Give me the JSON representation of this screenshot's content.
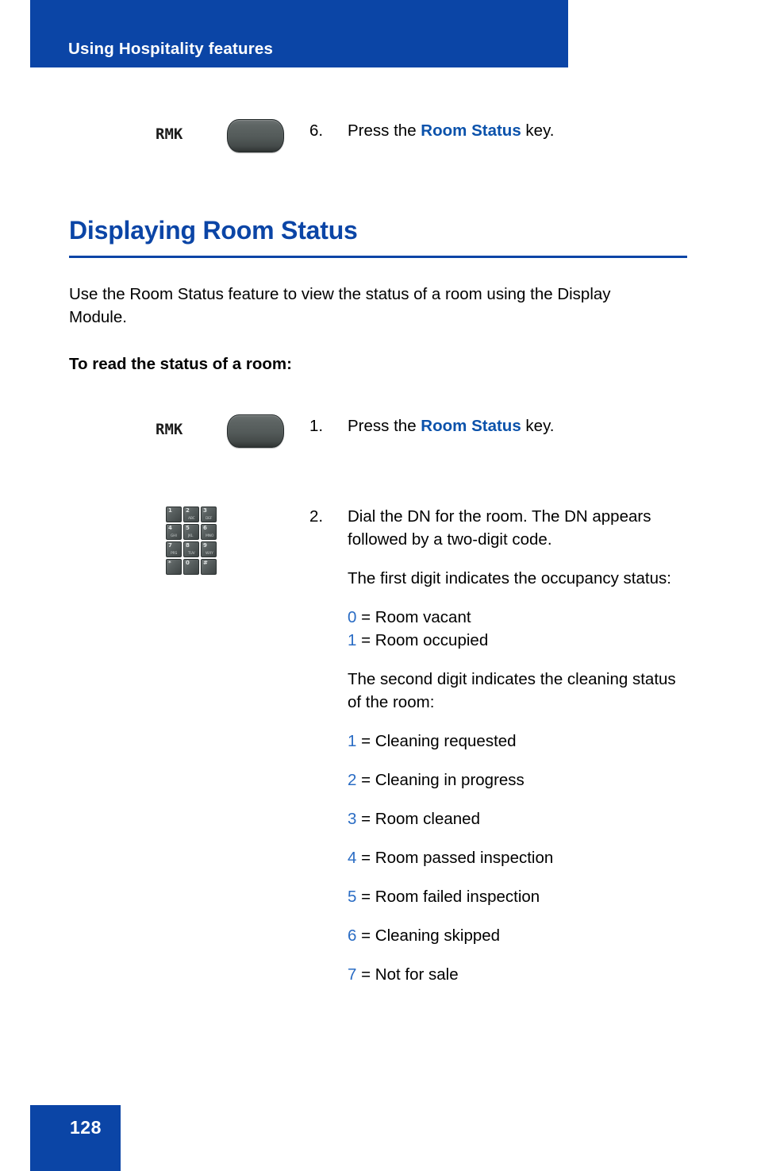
{
  "header": {
    "title": "Using Hospitality features",
    "banner_color": "#0b45a6"
  },
  "section": {
    "heading": "Displaying Room Status",
    "rule_color": "#0b45a6",
    "intro": "Use the Room Status feature to view the status of a room using the Display Module.",
    "subheading": "To read the status of a room:"
  },
  "steps": [
    {
      "number": "6.",
      "icon_label": "RMK",
      "text_before": "Press the ",
      "keyword": "Room Status",
      "text_after": " key."
    },
    {
      "number": "1.",
      "icon_label": "RMK",
      "text_before": "Press the ",
      "keyword": "Room Status",
      "text_after": " key."
    },
    {
      "number": "2.",
      "paragraphs": [
        "Dial the DN for the room. The DN appears followed by a two-digit code.",
        "The first digit indicates the occupancy status:",
        "The second digit indicates the cleaning status of the room:"
      ]
    }
  ],
  "occupancy_codes": [
    {
      "digit": "0",
      "equals": " = ",
      "meaning": "Room vacant"
    },
    {
      "digit": "1",
      "equals": " = ",
      "meaning": "Room occupied"
    }
  ],
  "cleaning_codes": [
    {
      "digit": "1",
      "equals": " = ",
      "meaning": "Cleaning requested"
    },
    {
      "digit": "2",
      "equals": " = ",
      "meaning": "Cleaning in progress"
    },
    {
      "digit": "3",
      "equals": " = ",
      "meaning": "Room cleaned"
    },
    {
      "digit": "4",
      "equals": " = ",
      "meaning": "Room passed inspection"
    },
    {
      "digit": "5",
      "equals": " = ",
      "meaning": "Room failed inspection"
    },
    {
      "digit": "6",
      "equals": " = ",
      "meaning": "Cleaning skipped"
    },
    {
      "digit": "7",
      "equals": " = ",
      "meaning": "Not for sale"
    }
  ],
  "dialpad": {
    "keys": [
      {
        "num": "1",
        "alpha": ""
      },
      {
        "num": "2",
        "alpha": "ABC"
      },
      {
        "num": "3",
        "alpha": "DEF"
      },
      {
        "num": "4",
        "alpha": "GHI"
      },
      {
        "num": "5",
        "alpha": "JKL"
      },
      {
        "num": "6",
        "alpha": "MNO"
      },
      {
        "num": "7",
        "alpha": "PRS"
      },
      {
        "num": "8",
        "alpha": "TUV"
      },
      {
        "num": "9",
        "alpha": "WXY"
      },
      {
        "num": "*",
        "alpha": ""
      },
      {
        "num": "0",
        "alpha": ""
      },
      {
        "num": "#",
        "alpha": ""
      }
    ]
  },
  "footer": {
    "page_number": "128",
    "box_color": "#0b45a6"
  },
  "colors": {
    "brand_blue": "#0b45a6",
    "keyword_blue": "#0b52ab",
    "digit_blue": "#2a6cc4"
  }
}
